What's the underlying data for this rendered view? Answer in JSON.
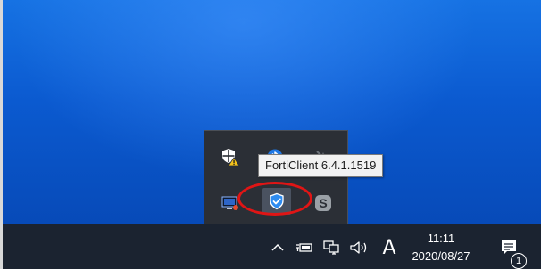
{
  "tooltip": {
    "text": "FortiClient 6.4.1.1519"
  },
  "overflow_tray": {
    "icons": [
      "windows-security-warning-icon",
      "bluetooth-icon",
      "network-disabled-icon",
      "display-monitor-icon",
      "forticlient-shield-icon",
      "skype-icon"
    ]
  },
  "taskbar": {
    "ime_mode": "A",
    "clock": {
      "time": "11:11",
      "date": "2020/08/27"
    },
    "notification_count": "1"
  },
  "colors": {
    "desktop": "#0b5ad0",
    "taskbar": "#1b2330",
    "tray_flyout": "#2b2f36",
    "highlight": "#e01515",
    "forticlient_accent": "#2f8cf0"
  }
}
